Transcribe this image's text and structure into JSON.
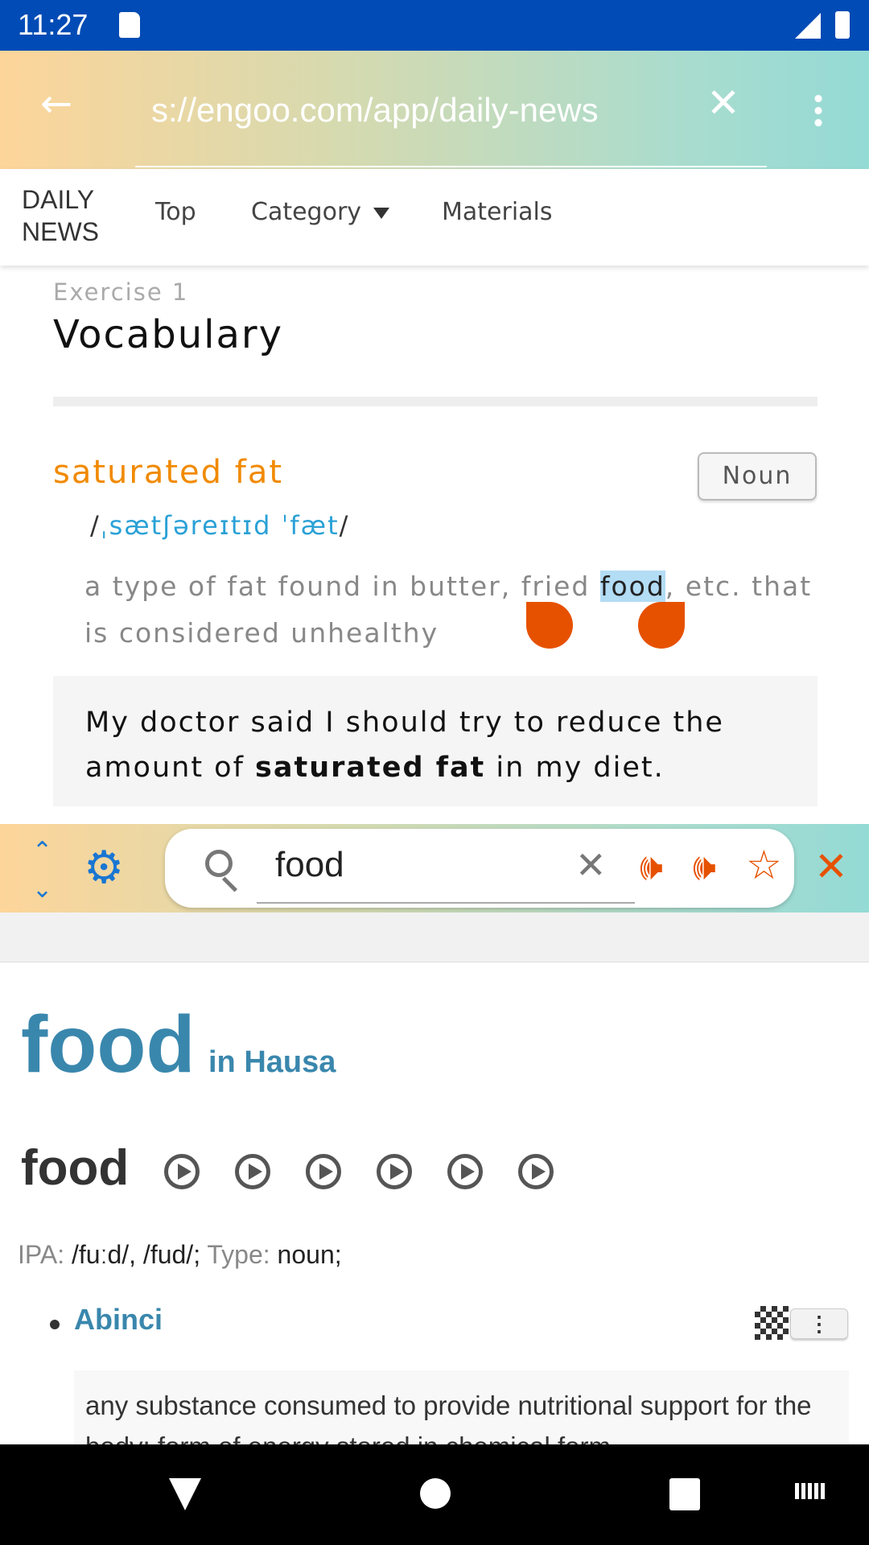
{
  "status": {
    "time": "11:27"
  },
  "browser": {
    "url": "s://engoo.com/app/daily-news"
  },
  "site_nav": {
    "logo_line1": "DAILY",
    "logo_line2": "NEWS",
    "items": [
      "Top",
      "Category",
      "Materials"
    ]
  },
  "exercise": {
    "label": "Exercise 1",
    "title": "Vocabulary"
  },
  "vocab": {
    "word": "saturated fat",
    "pos": "Noun",
    "phonetic_open": "/",
    "phonetic": "ˌsætʃəreɪtɪd ˈfæt",
    "phonetic_close": "/",
    "def_before": "a type of fat found in butter, fried ",
    "def_selected": "food",
    "def_after": ", etc. that is considered unhealthy",
    "example_before": "My doctor said I should try to reduce the amount of ",
    "example_bold": "saturated fat",
    "example_after": " in my diet."
  },
  "dict_toolbar": {
    "query": "food"
  },
  "dictionary": {
    "headword": "food",
    "lang": "in Hausa",
    "entry": "food",
    "ipa_label": "IPA:",
    "ipa": "/fuːd/, /fud/;",
    "type_label": "Type:",
    "type": "noun;",
    "translation": "Abinci",
    "definition": "any substance consumed to provide nutritional support for the body; form of energy stored in chemical form"
  },
  "colors": {
    "status_bar": "#004bb5",
    "accent_orange": "#e65100",
    "dict_blue": "#3a87ad",
    "vocab_orange": "#f18a00",
    "phonetic_blue": "#2aa1d6"
  }
}
